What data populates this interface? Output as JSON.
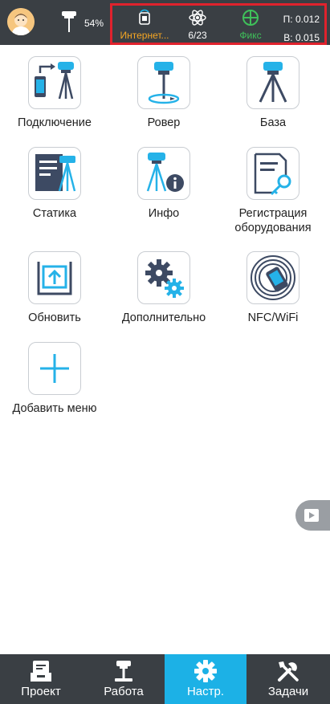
{
  "status_bar": {
    "battery": "54%",
    "internet_label": "Интернет...",
    "satellites": "6/23",
    "fix_label": "Фикс",
    "precision_h": "П: 0.012",
    "precision_v": "В: 0.015"
  },
  "menu": {
    "connection": "Подключение",
    "rover": "Ровер",
    "base": "База",
    "static": "Статика",
    "info": "Инфо",
    "registration": "Регистрация оборудования",
    "update": "Обновить",
    "additional": "Дополнительно",
    "nfc_wifi": "NFC/WiFi",
    "add_menu": "Добавить меню"
  },
  "nav": {
    "project": "Проект",
    "work": "Работа",
    "settings": "Настр.",
    "tasks": "Задачи",
    "active": "settings"
  },
  "colors": {
    "bar_bg": "#3a3f44",
    "accent": "#1cb1e6",
    "internet": "#f5a623",
    "fix": "#3fc05a",
    "highlight_box": "#e0222d"
  }
}
